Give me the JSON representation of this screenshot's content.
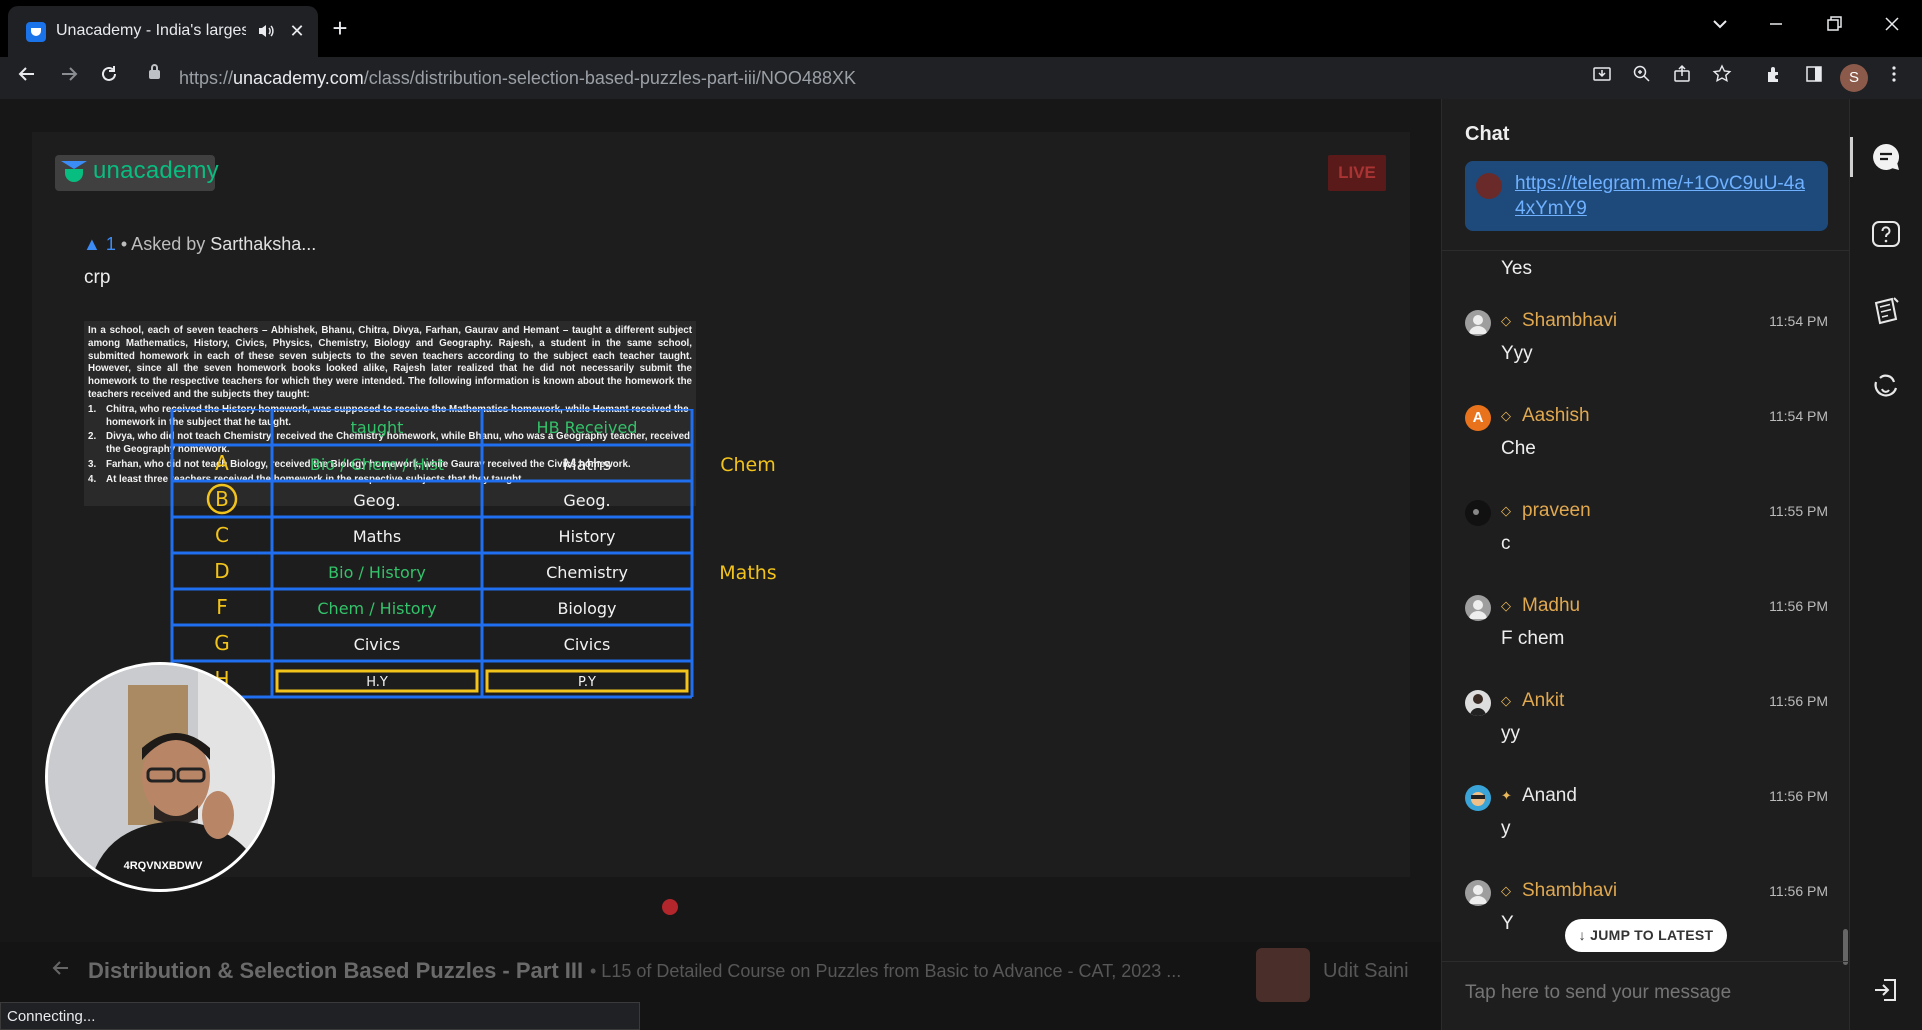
{
  "browser": {
    "tab_title": "Unacademy - India's largest l",
    "new_tab": "+",
    "url_prefix": "https://",
    "url_host": "unacademy.com",
    "url_path": "/class/distribution-selection-based-puzzles-part-iii/NOO488XK",
    "profile_initial": "S",
    "status": "Connecting..."
  },
  "player": {
    "brand": "unacademy",
    "live": "LIVE",
    "upvotes": "1",
    "asked_by_prefix": "• Asked by",
    "asker": "Sarthaksha...",
    "doubt_text": "crp",
    "camera_id": "4RQVNXBDWV"
  },
  "question": {
    "intro": "In a school, each of seven teachers – Abhishek, Bhanu, Chitra, Divya, Farhan, Gaurav and Hemant – taught a different subject among Mathematics, History, Civics, Physics, Chemistry, Biology and Geography. Rajesh, a student in the same school, submitted homework in each of these seven subjects to the seven teachers according to the subject each teacher taught. However, since all the seven homework books looked alike, Rajesh later realized that he did not necessarily submit the homework to the respective teachers for which they were intended. The following information is known about the homework the teachers received and the subjects they taught:",
    "items": [
      {
        "n": "1.",
        "text": "Chitra, who received the History homework, was supposed to receive the Mathematics homework, while Hemant received the homework in the subject that he taught."
      },
      {
        "n": "2.",
        "text": "Divya, who did not teach Chemistry, received the Chemistry homework, while Bhanu, who was a Geography teacher, received the Geography homework."
      },
      {
        "n": "3.",
        "text": "Farhan, who did not teach Biology, received the Biology homework, while Gaurav received the Civics homework."
      },
      {
        "n": "4.",
        "text": "At least three teachers received the homework in the respective subjects that they taught."
      }
    ]
  },
  "board": {
    "headers": [
      "taught",
      "HB Received"
    ],
    "rows": [
      {
        "label": "A",
        "taught": "Bio / Chem / Hist",
        "received": "Maths"
      },
      {
        "label": "B",
        "taught": "Geog.",
        "received": "Geog."
      },
      {
        "label": "C",
        "taught": "Maths",
        "received": "History"
      },
      {
        "label": "D",
        "taught": "Bio / History",
        "received": "Chemistry"
      },
      {
        "label": "F",
        "taught": "Chem / History",
        "received": "Biology"
      },
      {
        "label": "G",
        "taught": "Civics",
        "received": "Civics"
      },
      {
        "label": "H",
        "taught": "H.Y",
        "received": "P.Y"
      }
    ],
    "side_notes": [
      "Chem",
      "Maths"
    ],
    "colors": {
      "grid": "#1f6ff0",
      "green": "#34c26a",
      "white": "#f2f2f2",
      "yellow": "#f2c31b"
    }
  },
  "footer": {
    "title": "Distribution & Selection Based Puzzles - Part III",
    "subtitle": "•  L15 of Detailed Course on Puzzles from Basic to Advance - CAT, 2023 ...",
    "educator": "Udit Saini"
  },
  "chat": {
    "title": "Chat",
    "pinned_link": "https://telegram.me/+1OvC9uU-4a4xYmY9",
    "messages": [
      {
        "name": "",
        "time": "",
        "text": "Yes",
        "avatar": "",
        "badge": ""
      },
      {
        "name": "Shambhavi",
        "time": "11:54 PM",
        "text": "Yyy",
        "avatar": "",
        "badge": "◇"
      },
      {
        "name": "Aashish",
        "time": "11:54 PM",
        "text": "Che",
        "avatar": "A",
        "badge": "◇"
      },
      {
        "name": "praveen",
        "time": "11:55 PM",
        "text": "c",
        "avatar": "",
        "badge": "◇"
      },
      {
        "name": "Madhu",
        "time": "11:56 PM",
        "text": "F chem",
        "avatar": "",
        "badge": "◇"
      },
      {
        "name": "Ankit",
        "time": "11:56 PM",
        "text": "yy",
        "avatar": "",
        "badge": "◇"
      },
      {
        "name": "Anand",
        "time": "11:56 PM",
        "text": "y",
        "avatar": "",
        "badge": "✦"
      },
      {
        "name": "Shambhavi",
        "time": "11:56 PM",
        "text": "Y",
        "avatar": "",
        "badge": "◇"
      }
    ],
    "jump_label": "↓  JUMP TO LATEST",
    "input_placeholder": "Tap here to send your message"
  },
  "icons": {
    "rail": [
      "chat-icon",
      "doubt-icon",
      "notes-icon",
      "poll-icon",
      "exit-icon"
    ]
  },
  "colors": {
    "accent_green": "#08bd80",
    "link_blue": "#6fb0ff",
    "pinned_bg": "#1d4a7b",
    "gold": "#e0a84f"
  }
}
